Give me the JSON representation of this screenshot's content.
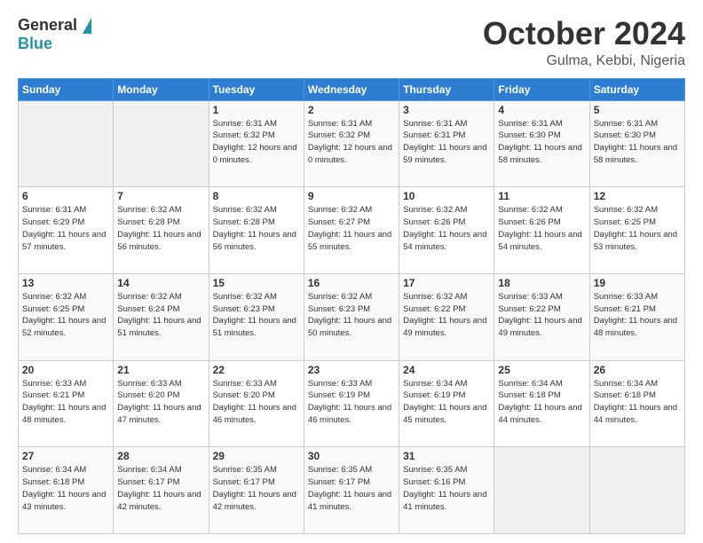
{
  "logo": {
    "general": "General",
    "blue": "Blue"
  },
  "header": {
    "month": "October 2024",
    "location": "Gulma, Kebbi, Nigeria"
  },
  "weekdays": [
    "Sunday",
    "Monday",
    "Tuesday",
    "Wednesday",
    "Thursday",
    "Friday",
    "Saturday"
  ],
  "weeks": [
    [
      {
        "day": "",
        "info": ""
      },
      {
        "day": "",
        "info": ""
      },
      {
        "day": "1",
        "info": "Sunrise: 6:31 AM\nSunset: 6:32 PM\nDaylight: 12 hours\nand 0 minutes."
      },
      {
        "day": "2",
        "info": "Sunrise: 6:31 AM\nSunset: 6:32 PM\nDaylight: 12 hours\nand 0 minutes."
      },
      {
        "day": "3",
        "info": "Sunrise: 6:31 AM\nSunset: 6:31 PM\nDaylight: 11 hours\nand 59 minutes."
      },
      {
        "day": "4",
        "info": "Sunrise: 6:31 AM\nSunset: 6:30 PM\nDaylight: 11 hours\nand 58 minutes."
      },
      {
        "day": "5",
        "info": "Sunrise: 6:31 AM\nSunset: 6:30 PM\nDaylight: 11 hours\nand 58 minutes."
      }
    ],
    [
      {
        "day": "6",
        "info": "Sunrise: 6:31 AM\nSunset: 6:29 PM\nDaylight: 11 hours\nand 57 minutes."
      },
      {
        "day": "7",
        "info": "Sunrise: 6:32 AM\nSunset: 6:28 PM\nDaylight: 11 hours\nand 56 minutes."
      },
      {
        "day": "8",
        "info": "Sunrise: 6:32 AM\nSunset: 6:28 PM\nDaylight: 11 hours\nand 56 minutes."
      },
      {
        "day": "9",
        "info": "Sunrise: 6:32 AM\nSunset: 6:27 PM\nDaylight: 11 hours\nand 55 minutes."
      },
      {
        "day": "10",
        "info": "Sunrise: 6:32 AM\nSunset: 6:26 PM\nDaylight: 11 hours\nand 54 minutes."
      },
      {
        "day": "11",
        "info": "Sunrise: 6:32 AM\nSunset: 6:26 PM\nDaylight: 11 hours\nand 54 minutes."
      },
      {
        "day": "12",
        "info": "Sunrise: 6:32 AM\nSunset: 6:25 PM\nDaylight: 11 hours\nand 53 minutes."
      }
    ],
    [
      {
        "day": "13",
        "info": "Sunrise: 6:32 AM\nSunset: 6:25 PM\nDaylight: 11 hours\nand 52 minutes."
      },
      {
        "day": "14",
        "info": "Sunrise: 6:32 AM\nSunset: 6:24 PM\nDaylight: 11 hours\nand 51 minutes."
      },
      {
        "day": "15",
        "info": "Sunrise: 6:32 AM\nSunset: 6:23 PM\nDaylight: 11 hours\nand 51 minutes."
      },
      {
        "day": "16",
        "info": "Sunrise: 6:32 AM\nSunset: 6:23 PM\nDaylight: 11 hours\nand 50 minutes."
      },
      {
        "day": "17",
        "info": "Sunrise: 6:32 AM\nSunset: 6:22 PM\nDaylight: 11 hours\nand 49 minutes."
      },
      {
        "day": "18",
        "info": "Sunrise: 6:33 AM\nSunset: 6:22 PM\nDaylight: 11 hours\nand 49 minutes."
      },
      {
        "day": "19",
        "info": "Sunrise: 6:33 AM\nSunset: 6:21 PM\nDaylight: 11 hours\nand 48 minutes."
      }
    ],
    [
      {
        "day": "20",
        "info": "Sunrise: 6:33 AM\nSunset: 6:21 PM\nDaylight: 11 hours\nand 48 minutes."
      },
      {
        "day": "21",
        "info": "Sunrise: 6:33 AM\nSunset: 6:20 PM\nDaylight: 11 hours\nand 47 minutes."
      },
      {
        "day": "22",
        "info": "Sunrise: 6:33 AM\nSunset: 6:20 PM\nDaylight: 11 hours\nand 46 minutes."
      },
      {
        "day": "23",
        "info": "Sunrise: 6:33 AM\nSunset: 6:19 PM\nDaylight: 11 hours\nand 46 minutes."
      },
      {
        "day": "24",
        "info": "Sunrise: 6:34 AM\nSunset: 6:19 PM\nDaylight: 11 hours\nand 45 minutes."
      },
      {
        "day": "25",
        "info": "Sunrise: 6:34 AM\nSunset: 6:18 PM\nDaylight: 11 hours\nand 44 minutes."
      },
      {
        "day": "26",
        "info": "Sunrise: 6:34 AM\nSunset: 6:18 PM\nDaylight: 11 hours\nand 44 minutes."
      }
    ],
    [
      {
        "day": "27",
        "info": "Sunrise: 6:34 AM\nSunset: 6:18 PM\nDaylight: 11 hours\nand 43 minutes."
      },
      {
        "day": "28",
        "info": "Sunrise: 6:34 AM\nSunset: 6:17 PM\nDaylight: 11 hours\nand 42 minutes."
      },
      {
        "day": "29",
        "info": "Sunrise: 6:35 AM\nSunset: 6:17 PM\nDaylight: 11 hours\nand 42 minutes."
      },
      {
        "day": "30",
        "info": "Sunrise: 6:35 AM\nSunset: 6:17 PM\nDaylight: 11 hours\nand 41 minutes."
      },
      {
        "day": "31",
        "info": "Sunrise: 6:35 AM\nSunset: 6:16 PM\nDaylight: 11 hours\nand 41 minutes."
      },
      {
        "day": "",
        "info": ""
      },
      {
        "day": "",
        "info": ""
      }
    ]
  ]
}
